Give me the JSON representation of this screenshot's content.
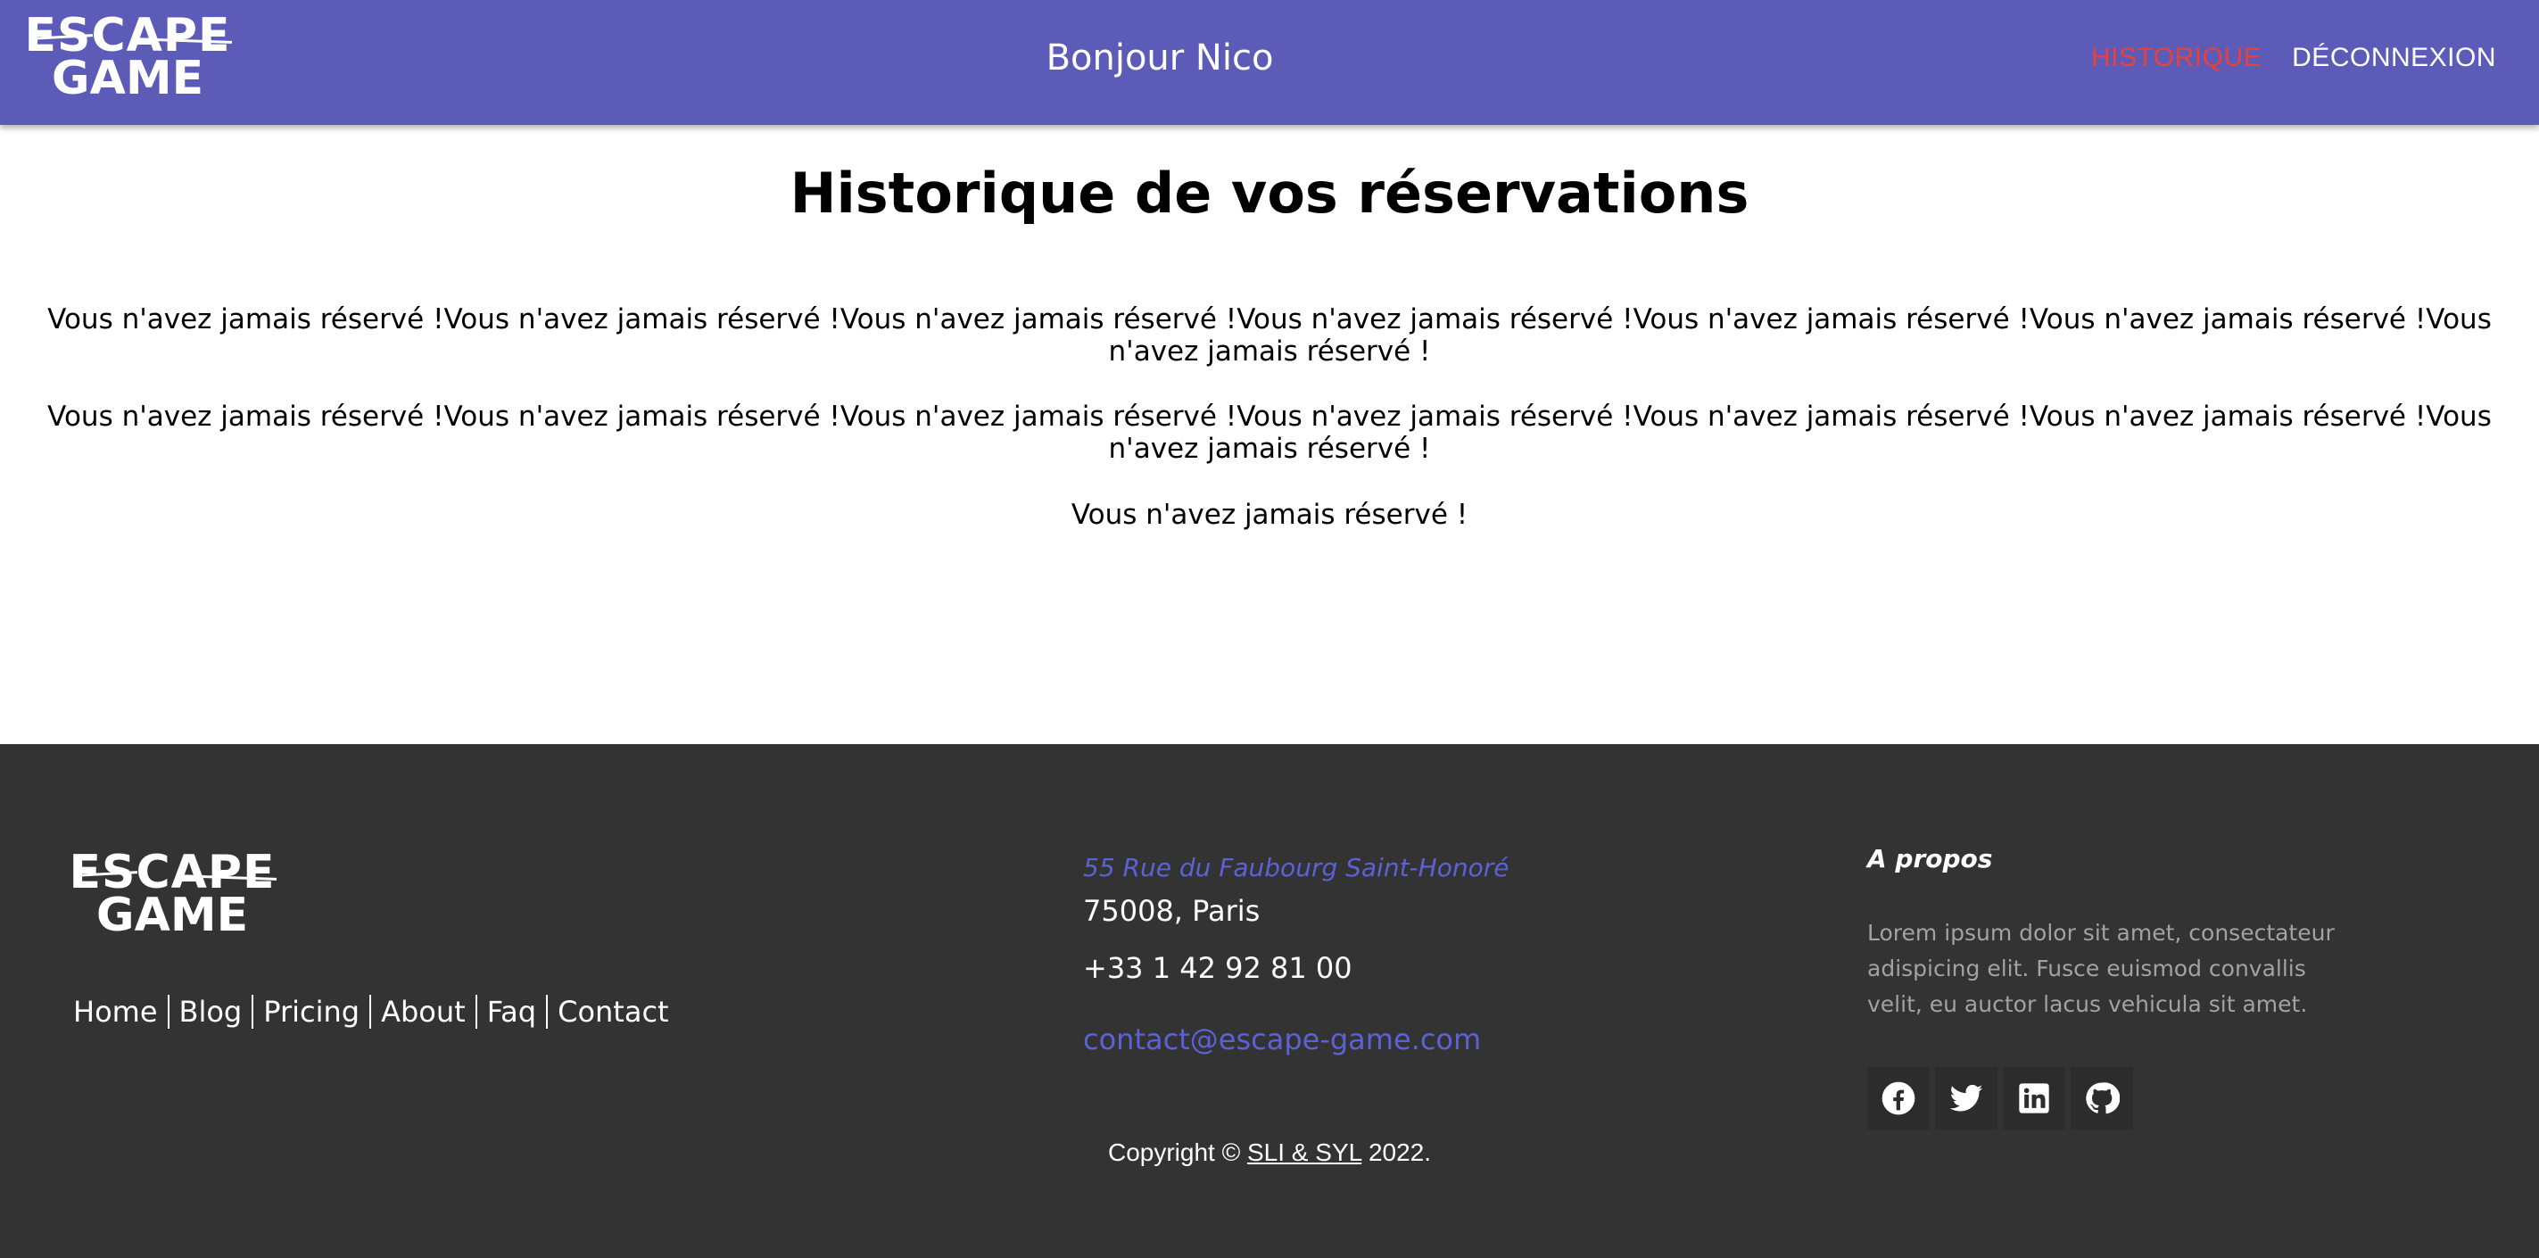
{
  "header": {
    "logo_top": "ESCAPE",
    "logo_bottom": "GAME",
    "greeting": "Bonjour Nico",
    "nav": [
      {
        "label": "HISTORIQUE"
      },
      {
        "label": "DÉCONNEXION"
      }
    ],
    "colors": {
      "background": "#5c5cb8",
      "active_link": "#e8413c"
    }
  },
  "main": {
    "title": "Historique de vos réservations",
    "lines": [
      "Vous n'avez jamais réservé !Vous n'avez jamais réservé !Vous n'avez jamais réservé !Vous n'avez jamais réservé !Vous n'avez jamais réservé !Vous n'avez jamais réservé !Vous n'avez jamais réservé !",
      "Vous n'avez jamais réservé !Vous n'avez jamais réservé !Vous n'avez jamais réservé !Vous n'avez jamais réservé !Vous n'avez jamais réservé !Vous n'avez jamais réservé !Vous n'avez jamais réservé !",
      "Vous n'avez jamais réservé !"
    ]
  },
  "footer": {
    "logo_top": "ESCAPE",
    "logo_bottom": "GAME",
    "links": [
      {
        "label": "Home"
      },
      {
        "label": "Blog"
      },
      {
        "label": "Pricing"
      },
      {
        "label": "About"
      },
      {
        "label": "Faq"
      },
      {
        "label": "Contact"
      }
    ],
    "address": {
      "street": "55 Rue du Faubourg Saint-Honoré",
      "city": "75008, Paris",
      "phone": "+33 1 42 92 81 00",
      "email": "contact@escape-game.com"
    },
    "about": {
      "title": "A propos",
      "text": "Lorem ipsum dolor sit amet, consectateur adispicing elit. Fusce euismod convallis velit, eu auctor lacus vehicula sit amet."
    },
    "socials": [
      {
        "icon": "facebook-icon"
      },
      {
        "icon": "twitter-icon"
      },
      {
        "icon": "linkedin-icon"
      },
      {
        "icon": "github-icon"
      }
    ],
    "copyright": {
      "prefix": "Copyright ©",
      "brand": "SLI & SYL",
      "suffix": "2022."
    },
    "colors": {
      "background": "#333333",
      "accent": "#5b62d6"
    }
  }
}
